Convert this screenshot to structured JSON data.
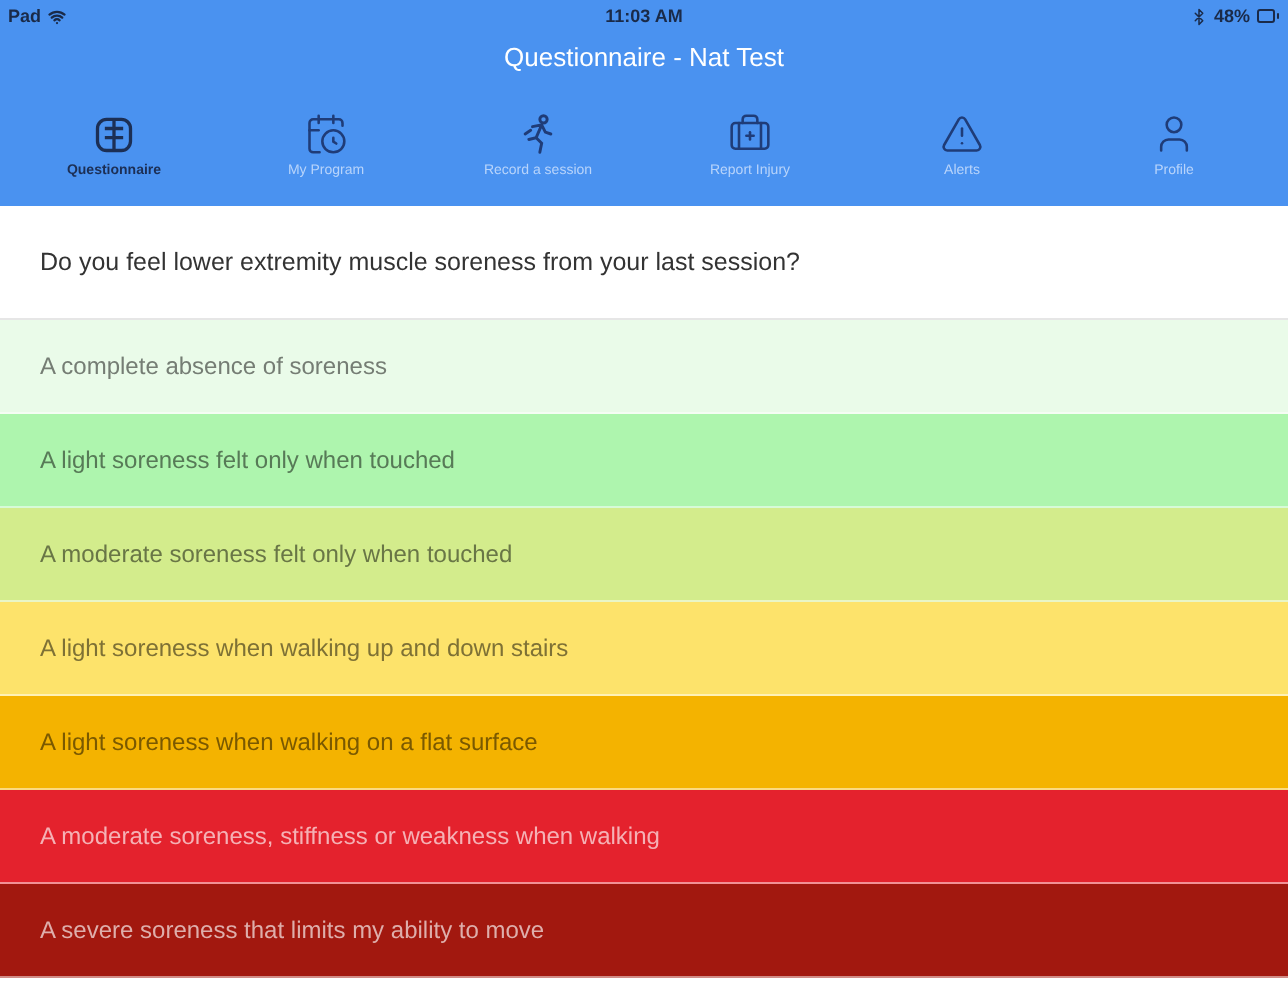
{
  "status_bar": {
    "device": "Pad",
    "time": "11:03 AM",
    "battery": "48%"
  },
  "window": {
    "title": "Questionnaire - Nat Test"
  },
  "tabs": [
    {
      "label": "Questionnaire",
      "kind": "body",
      "selected": true
    },
    {
      "label": "My Program",
      "kind": "calendar",
      "selected": false
    },
    {
      "label": "Record a session",
      "kind": "runner",
      "selected": false
    },
    {
      "label": "Report Injury",
      "kind": "medkit",
      "selected": false
    },
    {
      "label": "Alerts",
      "kind": "alert",
      "selected": false
    },
    {
      "label": "Profile",
      "kind": "profile",
      "selected": false
    }
  ],
  "question": "Do you feel lower extremity muscle soreness from your last session?",
  "options": [
    {
      "label": "A complete absence of soreness",
      "color": "#eafbe9"
    },
    {
      "label": "A light soreness felt only when touched",
      "color": "#aef5ae"
    },
    {
      "label": "A moderate soreness felt only when touched",
      "color": "#d3ec8c"
    },
    {
      "label": "A light soreness when walking up and down stairs",
      "color": "#fde36b"
    },
    {
      "label": "A light soreness when walking on a flat surface",
      "color": "#f4b300"
    },
    {
      "label": "A moderate soreness, stiffness or weakness when walking",
      "color": "#e4222d"
    },
    {
      "label": "A severe soreness that limits my ability to move",
      "color": "#a2180f"
    }
  ]
}
